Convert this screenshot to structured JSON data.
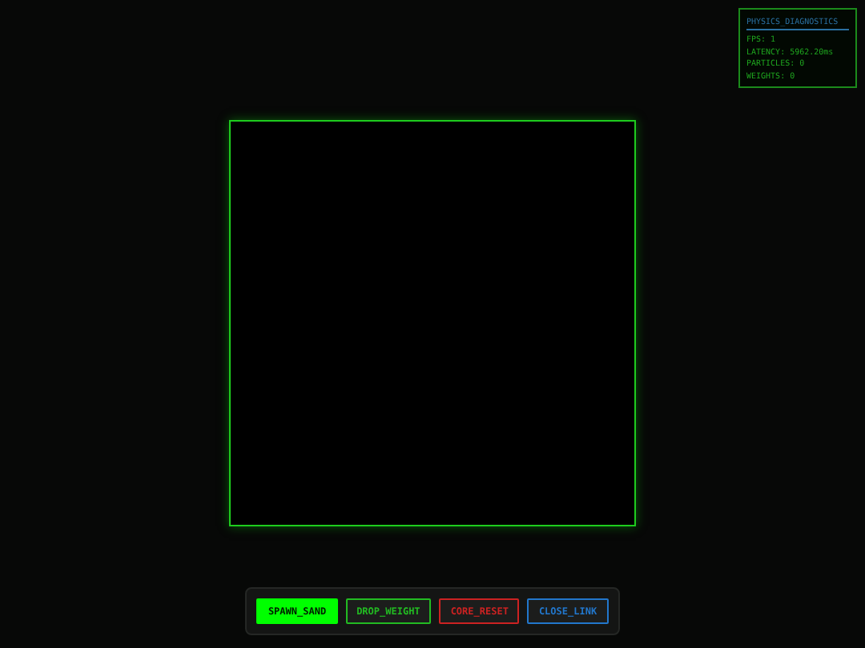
{
  "diagnostics": {
    "title": "PHYSICS_DIAGNOSTICS",
    "lines": [
      "FPS: 1",
      "LATENCY: 5962.20ms",
      "PARTICLES: 0",
      "WEIGHTS: 0"
    ]
  },
  "toolbar": {
    "buttons": [
      {
        "label": "SPAWN_SAND",
        "kind": "filled",
        "color": "#00ff00"
      },
      {
        "label": "DROP_WEIGHT",
        "kind": "outline",
        "color": "#22bb22"
      },
      {
        "label": "CORE_RESET",
        "kind": "outline",
        "color": "#cc2222"
      },
      {
        "label": "CLOSE_LINK",
        "kind": "outline",
        "color": "#2277cc"
      }
    ]
  }
}
